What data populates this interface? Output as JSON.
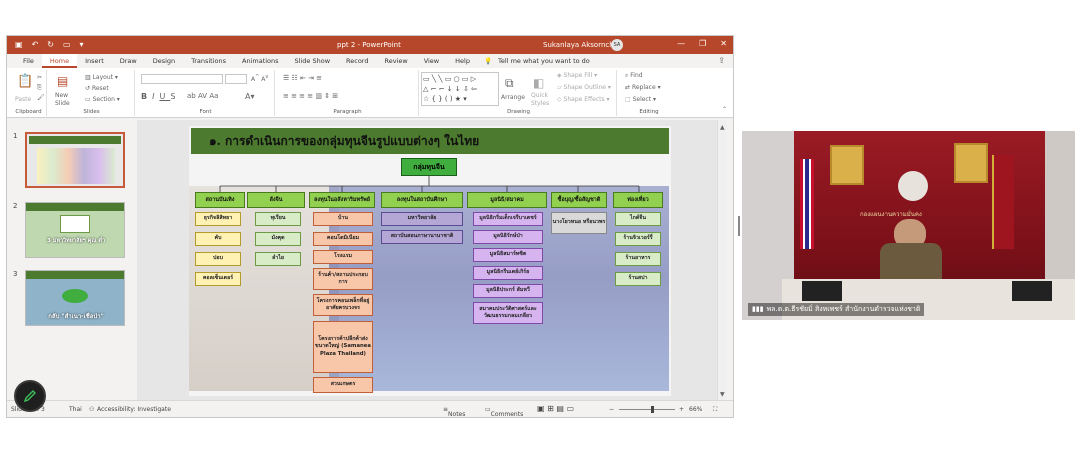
{
  "window": {
    "title": "ppt 2  -  PowerPoint",
    "user": "Sukanlaya Aksornchoo",
    "user_initials": "SA",
    "accent": "#b7472a"
  },
  "tabs": [
    "File",
    "Home",
    "Insert",
    "Draw",
    "Design",
    "Transitions",
    "Animations",
    "Slide Show",
    "Record",
    "Review",
    "View",
    "Help"
  ],
  "tell_me": "Tell me what you want to do",
  "ribbon": {
    "paste": "Paste",
    "clipboard": "Clipboard",
    "new_slide": "New\nSlide",
    "layout": "Layout",
    "reset": "Reset",
    "section": "Section",
    "slides": "Slides",
    "font": "Font",
    "paragraph": "Paragraph",
    "arrange": "Arrange",
    "quick_styles": "Quick\nStyles",
    "shape_fill": "Shape Fill",
    "shape_outline": "Shape Outline",
    "shape_effects": "Shape Effects",
    "drawing": "Drawing",
    "find": "Find",
    "replace": "Replace",
    "select": "Select",
    "editing": "Editing"
  },
  "thumbnails": [
    {
      "num": "1",
      "caption": ""
    },
    {
      "num": "2",
      "caption": "3 มหาวิทยาลัยฯ คุณ   ต่ำ"
    },
    {
      "num": "3",
      "caption": "กลับ \"สำเนา-เชือป่า\""
    }
  ],
  "slide": {
    "title": "๑. การดำเนินการของกลุ่มทุนจีนรูปแบบต่างๆ ในไทย",
    "root": "กลุ่มทุนจีน",
    "columns": [
      {
        "header": "สถานบันเทิง",
        "items": [
          "ธุรกิจลิสิทธา",
          "คับ",
          "ปอบ",
          "คอลเซ็นเตอร์"
        ]
      },
      {
        "header": "ลังจีน",
        "items": [
          "ทุเรียน",
          "มังคุด",
          "ลำไย"
        ]
      },
      {
        "header": "ลงทุนในอสังหาริมทรัพย์",
        "items": [
          "บ้าน",
          "คอนโดมิเนียม",
          "โรงแรม",
          "ร้านค้า/สถานประกอบการ",
          "โครงการคอนเพล็กที่อยู่อาศัยครบวงจร",
          "โครงการค้าปลีกค้าส่งขนาดใหญ่ (Samanea Plaza Thailand)",
          "สวนเกษตร"
        ]
      },
      {
        "header": "ลงทุนในสถาบันศึกษา",
        "items": [
          "มหาวิทยาลัย",
          "สถาบันสอนภาษานานาชาติ"
        ]
      },
      {
        "header": "มูลนิธิ/สมาคม",
        "items": [
          "มูลนิธิกริ่มเต็กเจรีบาเตชร์",
          "มูลนิธิรักษ์ป่า",
          "มูลนิธิสมาร์ทซิต",
          "มูลนิธิกรีนเดย์เกิร์ธ",
          "มูลนิธิประกร์ สัมหวี",
          "สมาคมประวัติศาสตร์และวัฒนธรรมกลมเกลียว"
        ]
      },
      {
        "header": "ซื้อบุญ/ซื้อสัญชาติ",
        "items": [
          "นางโยวหนอ หรือนวพร"
        ]
      },
      {
        "header": "ท่องเที่ยว",
        "items": [
          "ไกด์จีน",
          "ร้านจิวเวอร์รี่",
          "ร้านอาหาร",
          "ร้านสปา"
        ]
      }
    ]
  },
  "status": {
    "slide": "Slide 1 of 3",
    "language": "Thai",
    "accessibility": "Accessibility: Investigate",
    "notes": "Notes",
    "comments": "Comments",
    "zoom": "66%"
  },
  "video": {
    "caption": "พล.ต.ต.ธีรชัยมิ่ สิงหเพชร์ สำนักงานตำรวจแห่งชาติ",
    "sign": "กองแผนงานความมั่นคง"
  }
}
